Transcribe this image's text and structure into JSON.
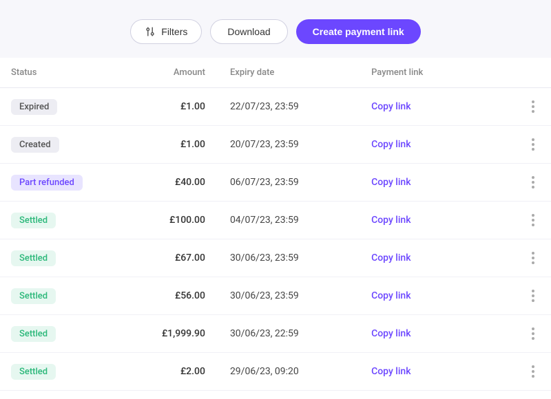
{
  "toolbar": {
    "filters_label": "Filters",
    "download_label": "Download",
    "create_label": "Create payment link"
  },
  "table": {
    "headers": {
      "status": "Status",
      "amount": "Amount",
      "expiry": "Expiry date",
      "payment_link": "Payment link"
    },
    "rows": [
      {
        "status": "Expired",
        "status_type": "expired",
        "amount": "£1.00",
        "expiry": "22/07/23, 23:59",
        "link_label": "Copy link"
      },
      {
        "status": "Created",
        "status_type": "created",
        "amount": "£1.00",
        "expiry": "20/07/23, 23:59",
        "link_label": "Copy link"
      },
      {
        "status": "Part refunded",
        "status_type": "part-refunded",
        "amount": "£40.00",
        "expiry": "06/07/23, 23:59",
        "link_label": "Copy link"
      },
      {
        "status": "Settled",
        "status_type": "settled",
        "amount": "£100.00",
        "expiry": "04/07/23, 23:59",
        "link_label": "Copy link"
      },
      {
        "status": "Settled",
        "status_type": "settled",
        "amount": "£67.00",
        "expiry": "30/06/23, 23:59",
        "link_label": "Copy link"
      },
      {
        "status": "Settled",
        "status_type": "settled",
        "amount": "£56.00",
        "expiry": "30/06/23, 23:59",
        "link_label": "Copy link"
      },
      {
        "status": "Settled",
        "status_type": "settled",
        "amount": "£1,999.90",
        "expiry": "30/06/23, 22:59",
        "link_label": "Copy link"
      },
      {
        "status": "Settled",
        "status_type": "settled",
        "amount": "£2.00",
        "expiry": "29/06/23, 09:20",
        "link_label": "Copy link"
      }
    ]
  }
}
